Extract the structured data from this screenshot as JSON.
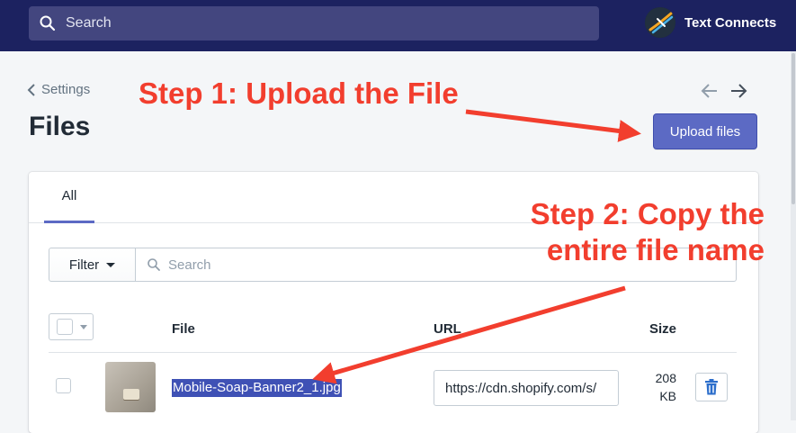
{
  "topbar": {
    "search_placeholder": "Search",
    "store_name": "Text Connects"
  },
  "header": {
    "breadcrumb": "Settings",
    "title": "Files",
    "upload_button": "Upload files"
  },
  "tabs": [
    {
      "label": "All",
      "active": true
    }
  ],
  "filter": {
    "button_label": "Filter",
    "search_placeholder": "Search"
  },
  "table": {
    "columns": {
      "file": "File",
      "url": "URL",
      "size": "Size"
    },
    "rows": [
      {
        "file_name": "Mobile-Soap-Banner2_1.jpg",
        "url": "https://cdn.shopify.com/s/",
        "size_value": "208",
        "size_unit": "KB"
      }
    ]
  },
  "annotations": {
    "step1": "Step 1: Upload the File",
    "step2_line1": "Step 2: Copy the",
    "step2_line2": "entire file name"
  },
  "colors": {
    "topbar": "#1c2260",
    "accent": "#5c6ac4",
    "annotation": "#f23e2e",
    "selection": "#3f51b5"
  }
}
